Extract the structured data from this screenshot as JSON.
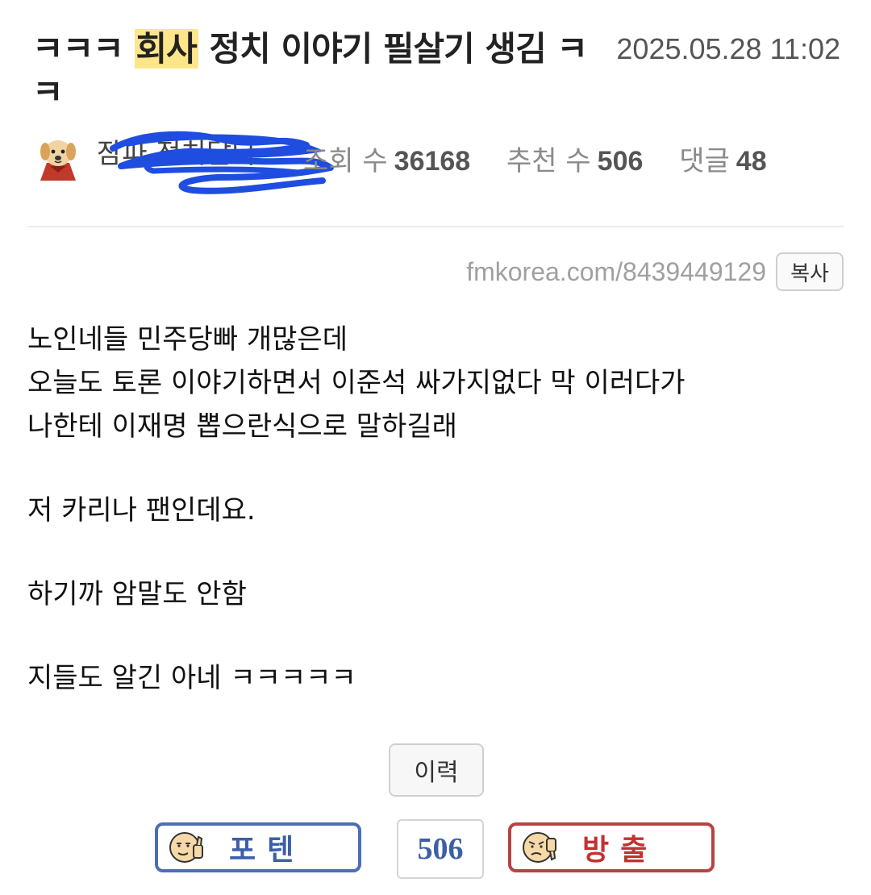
{
  "post": {
    "title_prefix": "ㅋㅋㅋ ",
    "title_highlight": "회사",
    "title_suffix": " 정치 이야기 필살기 생김 ㅋㅋ",
    "date": "2025.05.28 11:02"
  },
  "author": {
    "nickname": "잠파 정치달다"
  },
  "stats": {
    "views_label": "조회 수",
    "views": "36168",
    "recommend_label": "추천 수",
    "recommend": "506",
    "comments_label": "댓글",
    "comments": "48"
  },
  "link": {
    "url": "fmkorea.com/8439449129",
    "copy_label": "복사"
  },
  "body": {
    "lines": [
      "노인네들 민주당빠 개많은데",
      "오늘도 토론 이야기하면서 이준석 싸가지없다 막 이러다가",
      "나한테 이재명 뽑으란식으로 말하길래",
      "저 카리나 팬인데요.",
      "하기까 암말도 안함",
      "지들도 알긴 아네 ㅋㅋㅋㅋㅋ"
    ]
  },
  "actions": {
    "history_label": "이력",
    "upvote_label": "포텐",
    "vote_count": "506",
    "downvote_label": "방출"
  },
  "colors": {
    "highlight": "#fde68a",
    "upvote": "#3d5fa8",
    "downvote": "#c23232",
    "scribble": "#1f4de0"
  },
  "icons": {
    "avatar": "puppy-avatar-icon",
    "upvote": "thumbs-up-face-icon",
    "downvote": "thumbs-down-face-icon"
  }
}
